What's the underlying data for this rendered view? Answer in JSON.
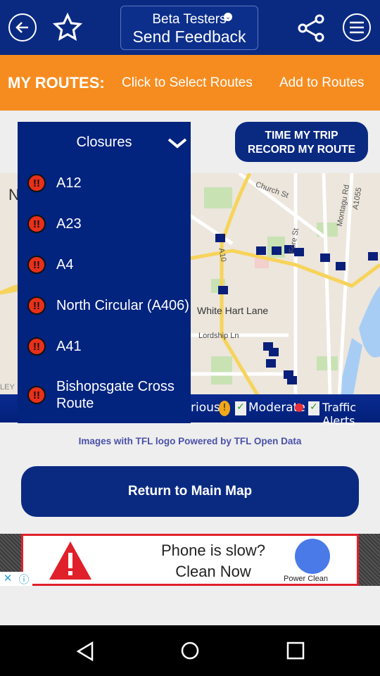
{
  "header": {
    "back_icon": "arrow-left-icon",
    "favorite_icon": "star-icon",
    "feedback_line1": "Beta Testers",
    "feedback_line2": "Send Feedback",
    "share_icon": "share-icon",
    "menu_icon": "hamburger-menu-icon"
  },
  "routes_bar": {
    "title": "MY ROUTES:",
    "select": "Click to Select Routes",
    "add": "Add to Routes"
  },
  "dropdown": {
    "selected": "Closures",
    "items": [
      {
        "label": "A12"
      },
      {
        "label": "A23"
      },
      {
        "label": "A4"
      },
      {
        "label": "North Circular (A406)"
      },
      {
        "label": "A41"
      },
      {
        "label": "Bishopsgate Cross Route"
      }
    ]
  },
  "time_trip": {
    "line1": "TIME MY TRIP",
    "line2": "RECORD MY ROUTE"
  },
  "map": {
    "labels": {
      "church": "Church St",
      "montagu": "Montagu Rd",
      "a1055": "A1055",
      "a10": "A10",
      "fore": "Fore St",
      "whl": "White Hart Lane",
      "lordship": "Lordship Ln",
      "n": "N",
      "ley": "LEY"
    }
  },
  "legend": {
    "serious": "rious",
    "moderate": "Moderate",
    "alerts": "Traffic Alerts"
  },
  "credit": "Images with TFL logo Powered by TFL Open Data",
  "return_button": "Return to Main Map",
  "ad": {
    "line1": "Phone is slow?",
    "line2": "Clean Now",
    "brand": "Power Clean"
  },
  "colors": {
    "navy": "#0a2a82",
    "orange": "#f68c1f",
    "closure_red": "#e8301a"
  }
}
